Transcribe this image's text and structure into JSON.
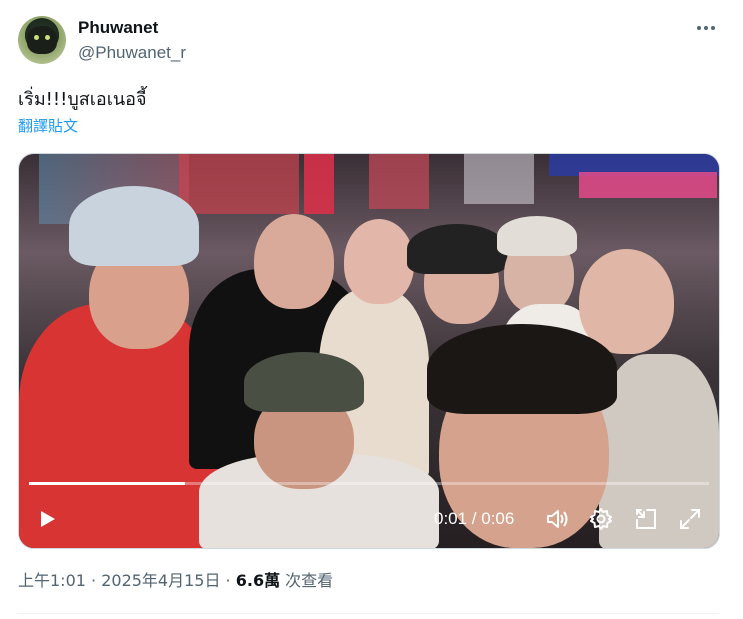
{
  "author": {
    "name": "Phuwanet",
    "handle": "@Phuwanet_r"
  },
  "more_icon": "more-horizontal-icon",
  "tweet": {
    "text": "เริ่ม!!!บูสเอเนอจี้",
    "translate_label": "翻譯貼文"
  },
  "video": {
    "time": "0:01 / 0:06",
    "progress": 0.23,
    "icons": [
      "play-icon",
      "volume-icon",
      "settings-icon",
      "pip-icon",
      "fullscreen-icon"
    ]
  },
  "meta": {
    "time": "上午1:01",
    "sep1": " · ",
    "date": "2025年4月15日",
    "sep2": " · ",
    "views": "6.6萬",
    "views_label": " 次查看"
  },
  "colors": {
    "accent": "#1d9bf0",
    "secondary_text": "#536471"
  }
}
